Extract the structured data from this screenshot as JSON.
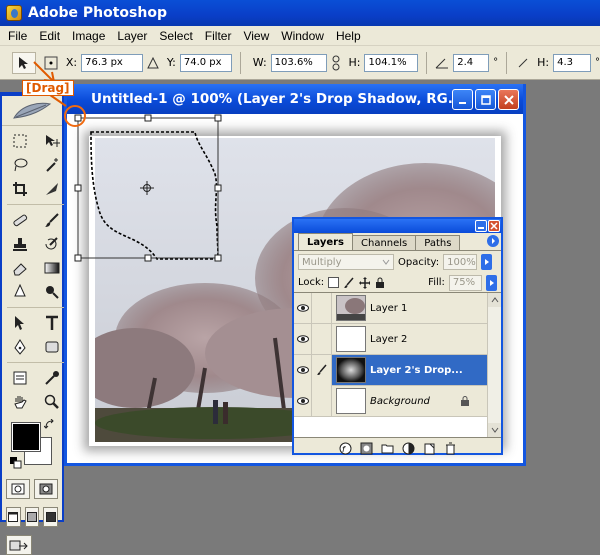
{
  "app": {
    "title": "Adobe Photoshop"
  },
  "menu": [
    "File",
    "Edit",
    "Image",
    "Layer",
    "Select",
    "Filter",
    "View",
    "Window",
    "Help"
  ],
  "options": {
    "x_label": "X:",
    "x_value": "76.3 px",
    "y_label": "Y:",
    "y_value": "74.0 px",
    "w_label": "W:",
    "w_value": "103.6%",
    "h_label": "H:",
    "h_value": "104.1%",
    "angle_value": "2.4",
    "angle_unit": "°",
    "hskew_label": "H:",
    "hskew_value": "4.3",
    "hskew_unit": "°"
  },
  "callout": {
    "text": "[Drag]"
  },
  "document": {
    "title": "Untitled-1 @ 100% (Layer 2's Drop Shadow, RG..."
  },
  "layers_panel": {
    "tabs": [
      "Layers",
      "Channels",
      "Paths"
    ],
    "blend_mode": "Multiply",
    "opacity_label": "Opacity:",
    "opacity_value": "100%",
    "lock_label": "Lock:",
    "fill_label": "Fill:",
    "fill_value": "75%",
    "layers": [
      {
        "name": "Layer 1",
        "selected": false
      },
      {
        "name": "Layer 2",
        "selected": false
      },
      {
        "name": "Layer 2's Drop...",
        "selected": true
      },
      {
        "name": "Background",
        "selected": false
      }
    ]
  },
  "colors": {
    "title_bar": "#0a3ec7",
    "selection": "#316ac5",
    "callout": "#e05a00",
    "panel_bg": "#ece9d8"
  }
}
